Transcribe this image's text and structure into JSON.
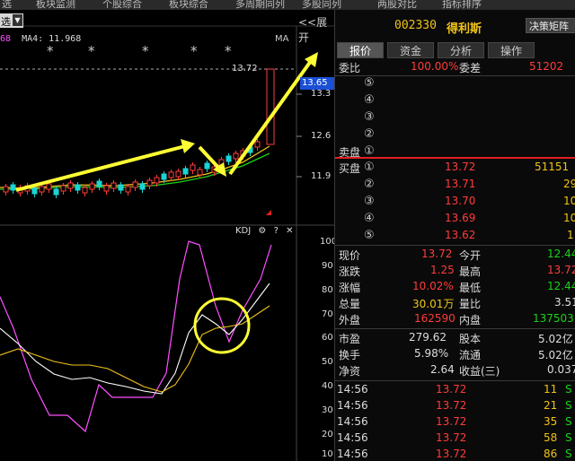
{
  "topbar": {
    "tabs": [
      "选",
      "板块监测",
      "个股综合",
      "板块综合",
      "多周期同列",
      "多股同列",
      "两股对比",
      "指标排序"
    ]
  },
  "chart": {
    "period_select": "选",
    "expand_label": "<<展开",
    "ma_left": "68",
    "ma4_label": "MA4: 11.968",
    "ma_right": "MA",
    "peak_price": "13.72",
    "current_price": "13.65",
    "price_labels": [
      "13.3",
      "12.6",
      "11.9"
    ],
    "stars": [
      "*",
      "*",
      "*",
      "*",
      "*"
    ],
    "kdj": {
      "title": "KDJ",
      "gear": "⚙",
      "help": "?",
      "close": "✕",
      "levels": [
        "100",
        "90",
        "80",
        "70",
        "60",
        "50",
        "40",
        "30",
        "20",
        "10"
      ]
    }
  },
  "quote": {
    "code": "002330",
    "name": "得利斯",
    "decide_button": "决策矩阵",
    "tabs": [
      "报价",
      "资金",
      "分析",
      "操作"
    ],
    "weibi_label": "委比",
    "weibi_value": "100.00%",
    "weicha_label": "委差",
    "weicha_value": "51202",
    "sell_label": "卖盘",
    "sell_rows": [
      {
        "n": "⑤",
        "price": "",
        "vol": ""
      },
      {
        "n": "④",
        "price": "",
        "vol": ""
      },
      {
        "n": "③",
        "price": "",
        "vol": ""
      },
      {
        "n": "②",
        "price": "",
        "vol": ""
      },
      {
        "n": "①",
        "price": "",
        "vol": ""
      }
    ],
    "buy_label": "买盘",
    "buy_rows": [
      {
        "n": "①",
        "price": "13.72",
        "vol": "51151"
      },
      {
        "n": "②",
        "price": "13.71",
        "vol": "29"
      },
      {
        "n": "③",
        "price": "13.70",
        "vol": "10"
      },
      {
        "n": "④",
        "price": "13.69",
        "vol": "10"
      },
      {
        "n": "⑤",
        "price": "13.62",
        "vol": "1"
      }
    ],
    "stats": [
      {
        "l1": "现价",
        "v1": "13.72",
        "c1": "red",
        "l2": "今开",
        "v2": "12.44",
        "c2": "green"
      },
      {
        "l1": "涨跌",
        "v1": "1.25",
        "c1": "red",
        "l2": "最高",
        "v2": "13.72",
        "c2": "red"
      },
      {
        "l1": "涨幅",
        "v1": "10.02%",
        "c1": "red",
        "l2": "最低",
        "v2": "12.44",
        "c2": "green"
      },
      {
        "l1": "总量",
        "v1": "30.01万",
        "c1": "yellow",
        "l2": "量比",
        "v2": "3.51",
        "c2": "white"
      },
      {
        "l1": "外盘",
        "v1": "162590",
        "c1": "red",
        "l2": "内盘",
        "v2": "137503",
        "c2": "green"
      }
    ],
    "stats2": [
      {
        "l1": "市盈",
        "v1": "279.62",
        "l2": "股本",
        "v2": "5.02亿"
      },
      {
        "l1": "换手",
        "v1": "5.98%",
        "l2": "流通",
        "v2": "5.02亿"
      },
      {
        "l1": "净资",
        "v1": "2.64",
        "l2": "收益(三)",
        "v2": "0.037"
      }
    ],
    "ticks": [
      {
        "time": "14:56",
        "price": "13.72",
        "vol": "11",
        "side": "S"
      },
      {
        "time": "14:56",
        "price": "13.72",
        "vol": "21",
        "side": "S"
      },
      {
        "time": "14:56",
        "price": "13.72",
        "vol": "35",
        "side": "S"
      },
      {
        "time": "14:56",
        "price": "13.72",
        "vol": "58",
        "side": "S"
      },
      {
        "time": "14:56",
        "price": "13.72",
        "vol": "86",
        "side": "S"
      }
    ]
  },
  "colors": {
    "red": "#ff3c3c",
    "green": "#19d419",
    "yellow": "#f0c419",
    "magenta": "#ff4fff",
    "arrow": "#ffff33",
    "buy_sell_divider": "#e02020"
  }
}
